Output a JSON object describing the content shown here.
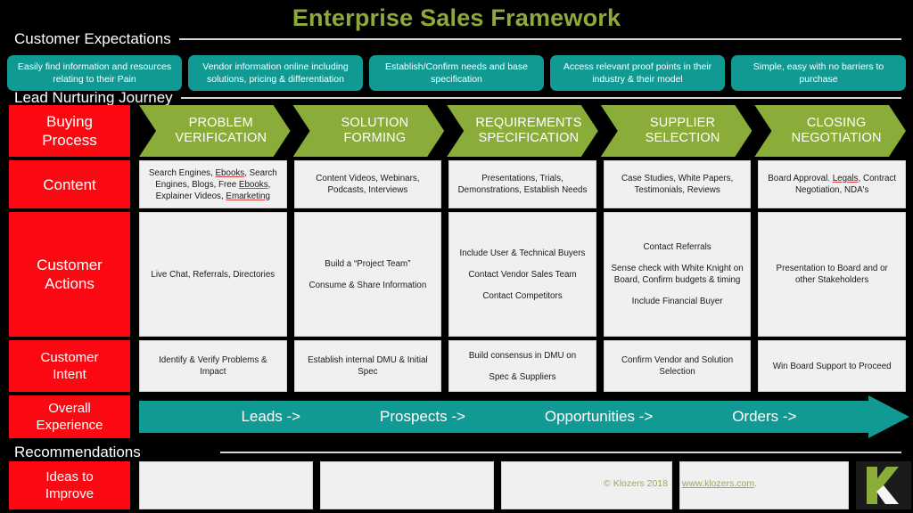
{
  "title": "Enterprise Sales Framework",
  "colors": {
    "background": "#000000",
    "title_green": "#8fa83b",
    "teal": "#119a94",
    "chevron_green": "#8aad3a",
    "label_red": "#fc0812",
    "cell_grey": "#f0f0f0",
    "rule_grey": "#d8d8d8",
    "footer_olive": "#9aa85c"
  },
  "sections": {
    "customer_expectations": "Customer Expectations",
    "lead_nurturing_journey": "Lead Nurturing Journey",
    "recommendations": "Recommendations"
  },
  "expectations": [
    "Easily find information and resources relating to their Pain",
    "Vendor information online including solutions, pricing & differentiation",
    "Establish/Confirm needs and base specification",
    "Access relevant proof points in their industry & their model",
    "Simple, easy with no barriers to purchase"
  ],
  "rows": {
    "buying_process": {
      "label_line1": "Buying",
      "label_line2": "Process",
      "stages": [
        {
          "line1": "PROBLEM",
          "line2": "VERIFICATION"
        },
        {
          "line1": "SOLUTION",
          "line2": "FORMING"
        },
        {
          "line1": "REQUIREMENTS",
          "line2": "SPECIFICATION"
        },
        {
          "line1": "SUPPLIER",
          "line2": "SELECTION"
        },
        {
          "line1": "CLOSING",
          "line2": "NEGOTIATION"
        }
      ]
    },
    "content": {
      "label": "Content",
      "cells": [
        {
          "parts": [
            {
              "t": "Search Engines, "
            },
            {
              "t": "Ebooks",
              "misspelled": true
            },
            {
              "t": ", Search Engines, Blogs, Free "
            },
            {
              "t": "Ebooks",
              "misspelled": true
            },
            {
              "t": ", Explainer Videos, "
            },
            {
              "t": "Emarketing",
              "misspelled": true
            }
          ]
        },
        {
          "parts": [
            {
              "t": "Content Videos, Webinars, Podcasts, Interviews"
            }
          ]
        },
        {
          "parts": [
            {
              "t": "Presentations, Trials, Demonstrations, Establish Needs"
            }
          ]
        },
        {
          "parts": [
            {
              "t": "Case Studies, White Papers, Testimonials, Reviews"
            }
          ]
        },
        {
          "parts": [
            {
              "t": "Board Approval. "
            },
            {
              "t": "Legals",
              "misspelled": true
            },
            {
              "t": ", Contract Negotiation, NDA's"
            }
          ]
        }
      ]
    },
    "customer_actions": {
      "label_line1": "Customer",
      "label_line2": "Actions",
      "cells": [
        [
          "Live Chat, Referrals, Directories"
        ],
        [
          "Build a “Project Team”",
          "Consume  & Share Information"
        ],
        [
          "Include User & Technical Buyers",
          "Contact Vendor Sales Team",
          "Contact Competitors"
        ],
        [
          "Contact Referrals",
          "Sense check with White Knight on Board, Confirm budgets & timing",
          "Include Financial Buyer"
        ],
        [
          "Presentation to Board and or other Stakeholders"
        ]
      ]
    },
    "customer_intent": {
      "label_line1": "Customer",
      "label_line2": "Intent",
      "cells": [
        [
          "Identify & Verify Problems & Impact"
        ],
        [
          "Establish internal DMU & Initial Spec"
        ],
        [
          "Build consensus in DMU on",
          "Spec & Suppliers"
        ],
        [
          "Confirm Vendor and Solution Selection"
        ],
        [
          "Win Board Support to Proceed"
        ]
      ]
    },
    "overall_experience": {
      "label_line1": "Overall",
      "label_line2": "Experience",
      "stages": [
        "Leads ->",
        "Prospects ->",
        "Opportunities ->",
        "Orders ->"
      ]
    },
    "ideas_to_improve": {
      "label_line1": "Ideas to",
      "label_line2": "Improve",
      "cells": [
        "",
        "",
        "",
        "",
        ""
      ]
    }
  },
  "footer": {
    "copyright": "© Klozers 2018",
    "website": "www.klozers.com",
    "period": ".",
    "logo_letter": "K"
  }
}
